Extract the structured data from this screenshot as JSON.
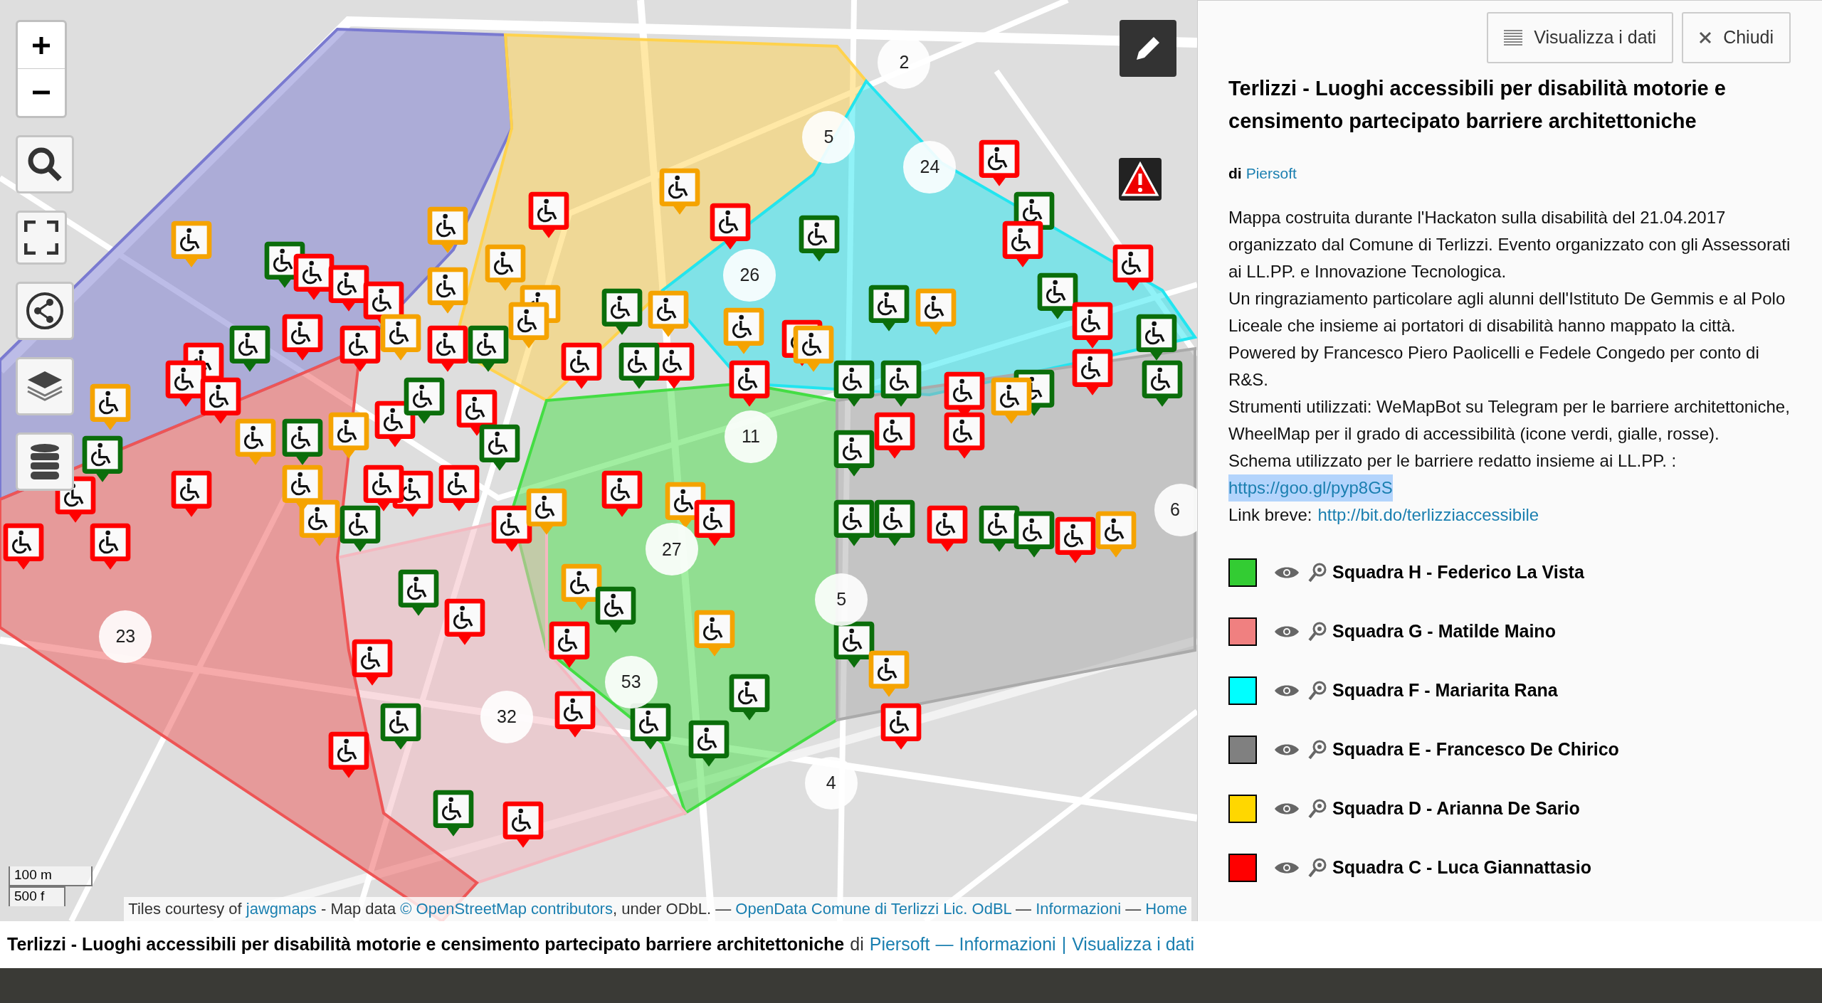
{
  "map": {
    "scale": [
      "100 m",
      "500 f"
    ],
    "attribution": [
      {
        "text": "Tiles courtesy of ",
        "link": false
      },
      {
        "text": "jawgmaps",
        "link": true
      },
      {
        "text": " - Map data ",
        "link": false
      },
      {
        "text": "© OpenStreetMap contributors",
        "link": true
      },
      {
        "text": ", under ODbL. — ",
        "link": false
      },
      {
        "text": "OpenData Comune di Terlizzi Lic. OdBL",
        "link": true
      },
      {
        "text": " — ",
        "link": false
      },
      {
        "text": "Informazioni",
        "link": true
      },
      {
        "text": " — ",
        "link": false
      },
      {
        "text": "Home",
        "link": true
      }
    ],
    "clusters": [
      {
        "count": "2"
      },
      {
        "count": "5"
      },
      {
        "count": "24"
      },
      {
        "count": "26"
      },
      {
        "count": "11"
      },
      {
        "count": "27"
      },
      {
        "count": "5"
      },
      {
        "count": "53"
      },
      {
        "count": "32"
      },
      {
        "count": "23"
      },
      {
        "count": "4"
      },
      {
        "count": "6"
      }
    ],
    "markers": [
      {
        "color": "#f5a300"
      },
      {
        "color": "#f5a300"
      },
      {
        "color": "#ff0000"
      },
      {
        "color": "#f5a300"
      },
      {
        "color": "#ff0000"
      },
      {
        "color": "#0b6e0b"
      },
      {
        "color": "#f5a300"
      },
      {
        "color": "#0b6e0b"
      },
      {
        "color": "#ff0000"
      },
      {
        "color": "#ff0000"
      },
      {
        "color": "#ff0000"
      },
      {
        "color": "#f5a300"
      },
      {
        "color": "#f5a300"
      },
      {
        "color": "#0b6e0b"
      },
      {
        "color": "#f5a300"
      },
      {
        "color": "#f5a300"
      },
      {
        "color": "#ff0000"
      },
      {
        "color": "#0b6e0b"
      },
      {
        "color": "#f5a300"
      },
      {
        "color": "#ff0000"
      },
      {
        "color": "#0b6e0b"
      },
      {
        "color": "#ff0000"
      },
      {
        "color": "#ff0000"
      },
      {
        "color": "#0b6e0b"
      },
      {
        "color": "#ff0000"
      },
      {
        "color": "#0b6e0b"
      },
      {
        "color": "#0b6e0b"
      },
      {
        "color": "#ff0000"
      },
      {
        "color": "#0b6e0b"
      },
      {
        "color": "#ff0000"
      },
      {
        "color": "#0b6e0b"
      },
      {
        "color": "#0b6e0b"
      },
      {
        "color": "#f5a300"
      },
      {
        "color": "#ff0000"
      },
      {
        "color": "#ff0000"
      },
      {
        "color": "#0b6e0b"
      },
      {
        "color": "#ff0000"
      },
      {
        "color": "#f5a300"
      },
      {
        "color": "#0b6e0b"
      },
      {
        "color": "#ff0000"
      },
      {
        "color": "#f5a300"
      },
      {
        "color": "#ff0000"
      },
      {
        "color": "#ff0000"
      },
      {
        "color": "#0b6e0b"
      },
      {
        "color": "#ff0000"
      },
      {
        "color": "#ff0000"
      },
      {
        "color": "#ff0000"
      },
      {
        "color": "#f5a300"
      },
      {
        "color": "#0b6e0b"
      },
      {
        "color": "#ff0000"
      },
      {
        "color": "#ff0000"
      },
      {
        "color": "#ff0000"
      },
      {
        "color": "#ff0000"
      },
      {
        "color": "#f5a300"
      },
      {
        "color": "#0b6e0b"
      },
      {
        "color": "#f5a300"
      },
      {
        "color": "#ff0000"
      },
      {
        "color": "#0b6e0b"
      },
      {
        "color": "#ff0000"
      },
      {
        "color": "#0b6e0b"
      },
      {
        "color": "#ff0000"
      },
      {
        "color": "#ff0000"
      },
      {
        "color": "#0b6e0b"
      },
      {
        "color": "#f5a300"
      },
      {
        "color": "#ff0000"
      },
      {
        "color": "#f5a300"
      },
      {
        "color": "#ff0000"
      },
      {
        "color": "#f5a300"
      },
      {
        "color": "#ff0000"
      },
      {
        "color": "#f5a300"
      },
      {
        "color": "#ff0000"
      },
      {
        "color": "#0b6e0b"
      },
      {
        "color": "#0b6e0b"
      },
      {
        "color": "#ff0000"
      },
      {
        "color": "#0b6e0b"
      },
      {
        "color": "#0b6e0b"
      },
      {
        "color": "#ff0000"
      },
      {
        "color": "#f5a300"
      },
      {
        "color": "#0b6e0b"
      },
      {
        "color": "#ff0000"
      },
      {
        "color": "#ff0000"
      },
      {
        "color": "#f5a300"
      },
      {
        "color": "#0b6e0b"
      },
      {
        "color": "#ff0000"
      },
      {
        "color": "#f5a300"
      },
      {
        "color": "#0b6e0b"
      },
      {
        "color": "#ff0000"
      },
      {
        "color": "#ff0000"
      },
      {
        "color": "#0b6e0b"
      },
      {
        "color": "#0b6e0b"
      },
      {
        "color": "#f5a300"
      },
      {
        "color": "#0b6e0b"
      },
      {
        "color": "#0b6e0b"
      },
      {
        "color": "#f5a300"
      },
      {
        "color": "#ff0000"
      },
      {
        "color": "#ff0000"
      },
      {
        "color": "#0b6e0b"
      },
      {
        "color": "#ff0000"
      },
      {
        "color": "#0b6e0b"
      },
      {
        "color": "#ff0000"
      }
    ]
  },
  "panel": {
    "buttons": [
      {
        "kind": "data",
        "label": "Visualizza i dati"
      },
      {
        "kind": "close",
        "label": "Chiudi"
      }
    ],
    "title": "Terlizzi - Luoghi accessibili per disabilità motorie e censimento partecipato barriere architettoniche",
    "by": "di",
    "author": "Piersoft",
    "description": [
      "Mappa costruita durante l'Hackaton sulla disabilità del 21.04.2017 organizzato dal Comune di Terlizzi. Evento organizzato con gli Assessorati ai LL.PP. e Innovazione Tecnologica.",
      "Un ringraziamento particolare agli alunni dell'Istituto De Gemmis e al Polo Liceale che insieme ai portatori di disabilità hanno mappato la città. Powered by Francesco Piero Paolicelli e Fedele Congedo per conto di R&S.",
      "Strumenti utilizzati: WeMapBot su Telegram per le barriere architettoniche, WheelMap per il grado di accessibilità (icone verdi, gialle, rosse).",
      "Schema utilizzato per le barriere redatto insieme ai LL.PP. :"
    ],
    "schema_link": {
      "text": "https://goo.gl/pyp8GS",
      "highlighted": true
    },
    "short_link": {
      "label": "Link breve:",
      "url": "http://bit.do/terlizziaccessibile"
    },
    "legend": [
      {
        "color": "#33cc33",
        "label": "Squadra H - Federico La Vista"
      },
      {
        "color": "#f08080",
        "label": "Squadra G - Matilde Maino"
      },
      {
        "color": "#00ffff",
        "label": "Squadra F - Mariarita Rana"
      },
      {
        "color": "#808080",
        "label": "Squadra E - Francesco De Chirico"
      },
      {
        "color": "#ffd700",
        "label": "Squadra D - Arianna De Sario"
      },
      {
        "color": "#ff0000",
        "label": "Squadra C - Luca Giannattasio"
      }
    ]
  },
  "footer": {
    "title": "Terlizzi - Luoghi accessibili per disabilità motorie e censimento partecipato barriere architettoniche",
    "by": "di",
    "links": [
      "Piersoft",
      "Informazioni",
      "Visualizza i dati"
    ],
    "separators": [
      "—",
      "|"
    ]
  }
}
